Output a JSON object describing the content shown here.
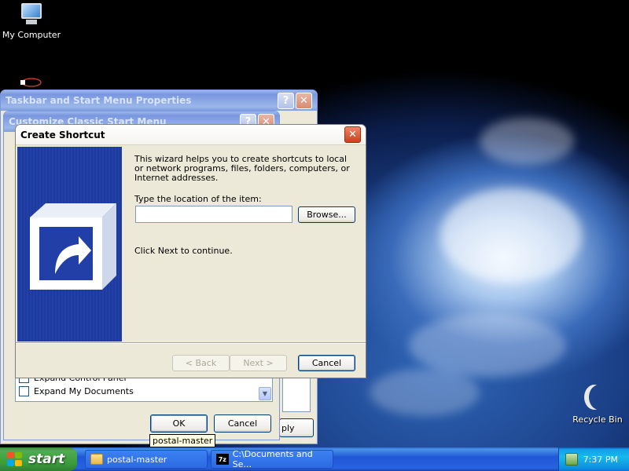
{
  "desktop": {
    "icons": [
      {
        "label": "My Computer",
        "icon": "my-computer-icon"
      },
      {
        "label": "Recycle Bin",
        "icon": "recycle-bin-icon"
      }
    ]
  },
  "taskbar_props_window": {
    "title": "Taskbar and Start Menu Properties",
    "apply_label": "ply"
  },
  "classic_start_window": {
    "title": "Customize Classic Start Menu",
    "options": [
      {
        "label": "Expand Control Panel",
        "checked": false
      },
      {
        "label": "Expand My Documents",
        "checked": false
      }
    ],
    "ok_label": "OK",
    "cancel_label": "Cancel"
  },
  "tooltip": {
    "text": "postal-master"
  },
  "create_shortcut": {
    "title": "Create Shortcut",
    "intro": "This wizard helps you to create shortcuts to local or network programs, files, folders, computers, or Internet addresses.",
    "location_label": "Type the location of the item:",
    "location_value": "",
    "browse_label": "Browse...",
    "continue_text": "Click Next to continue.",
    "back_label": "< Back",
    "next_label": "Next >",
    "cancel_label": "Cancel"
  },
  "taskbar": {
    "start_label": "start",
    "tasks": [
      {
        "label": "postal-master",
        "icon": "folder-icon"
      },
      {
        "label": "C:\\Documents and Se...",
        "icon": "7zip-icon"
      }
    ],
    "clock": "7:37 PM"
  },
  "colors": {
    "xp_blue": "#0831d9",
    "window_face": "#ece9d8",
    "wizard_banner": "#213fa6",
    "start_green": "#3b9a3b"
  }
}
